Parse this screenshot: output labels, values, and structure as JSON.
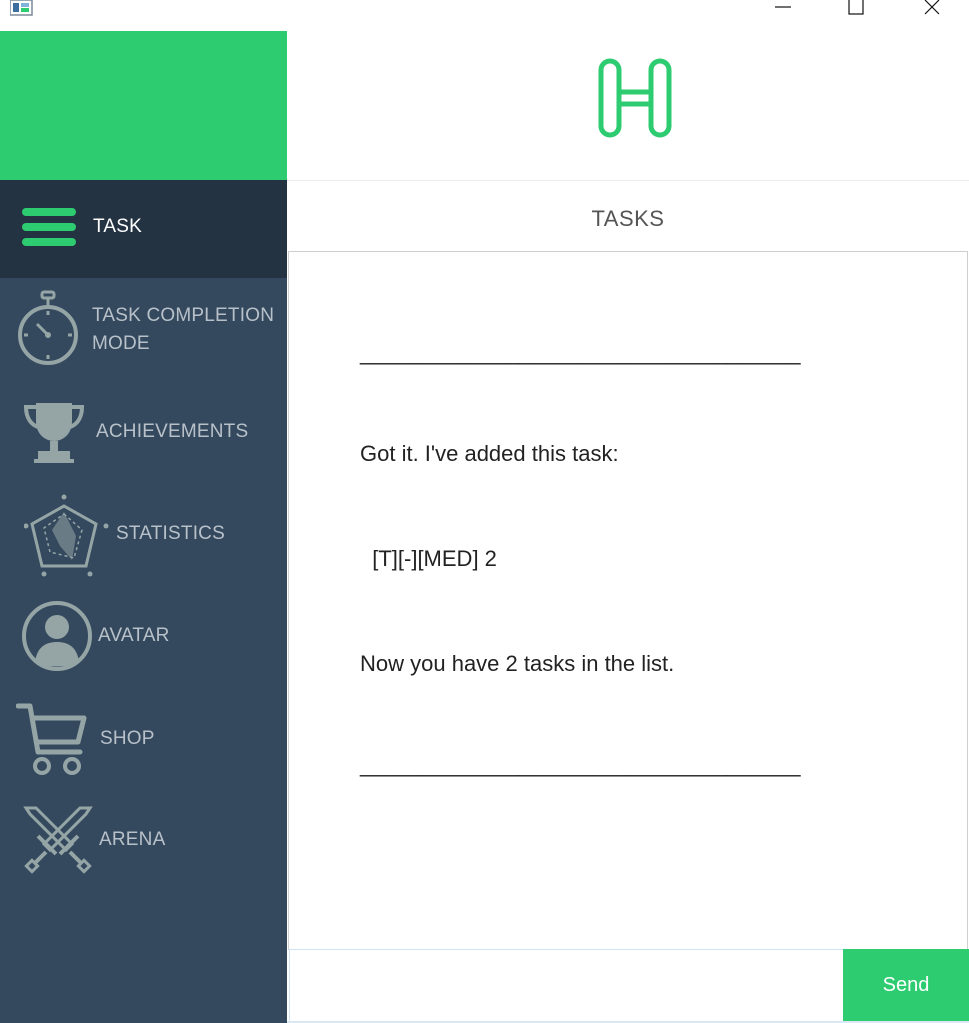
{
  "colors": {
    "accent": "#2ecc71",
    "sidebar": "#34495e",
    "sidebar_active": "#243342"
  },
  "sidebar": {
    "items": [
      {
        "label": "TASK",
        "icon": "hamburger-menu-icon",
        "active": true
      },
      {
        "label": "TASK COMPLETION",
        "label2": "MODE",
        "icon": "stopwatch-icon",
        "active": false
      },
      {
        "label": "ACHIEVEMENTS",
        "icon": "trophy-icon",
        "active": false
      },
      {
        "label": "STATISTICS",
        "icon": "radar-chart-icon",
        "active": false
      },
      {
        "label": "AVATAR",
        "icon": "user-avatar-icon",
        "active": false
      },
      {
        "label": "SHOP",
        "icon": "shopping-cart-icon",
        "active": false
      },
      {
        "label": "ARENA",
        "icon": "crossed-swords-icon",
        "active": false
      }
    ]
  },
  "main": {
    "logo_icon": "h-logo-icon",
    "title": "TASKS",
    "chat": {
      "separator": "____________________________________",
      "lines": [
        "Got it. I've added this task:",
        "  [T][-][MED] 2",
        "Now you have 2 tasks in the list."
      ]
    },
    "input": {
      "value": "",
      "placeholder": ""
    },
    "send_label": "Send"
  }
}
